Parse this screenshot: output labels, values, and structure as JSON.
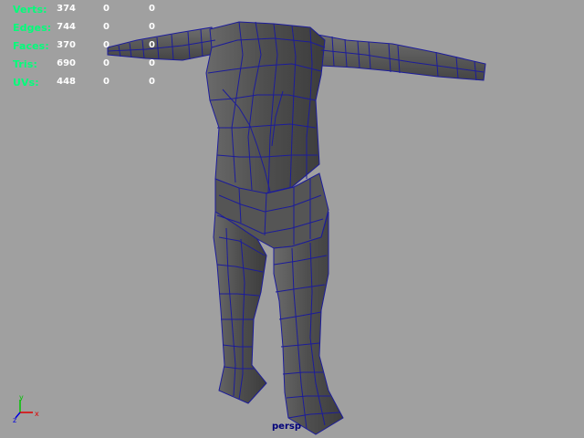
{
  "hud": {
    "rows": [
      {
        "label": "Verts:",
        "v1": "374",
        "v2": "0",
        "v3": "0"
      },
      {
        "label": "Edges:",
        "v1": "744",
        "v2": "0",
        "v3": "0"
      },
      {
        "label": "Faces:",
        "v1": "370",
        "v2": "0",
        "v3": "0"
      },
      {
        "label": "Tris:",
        "v1": "690",
        "v2": "0",
        "v3": "0"
      },
      {
        "label": "UVs:",
        "v1": "448",
        "v2": "0",
        "v3": "0"
      }
    ]
  },
  "camera": {
    "name": "persp"
  },
  "axis": {
    "x_label": "x",
    "y_label": "y",
    "z_label": "z"
  },
  "colors": {
    "background": "#a0a0a0",
    "mesh_fill": "#5c5c5c",
    "wireframe": "#1c1c9a",
    "hud_label": "#00ff7a",
    "hud_value": "#ffffff"
  }
}
